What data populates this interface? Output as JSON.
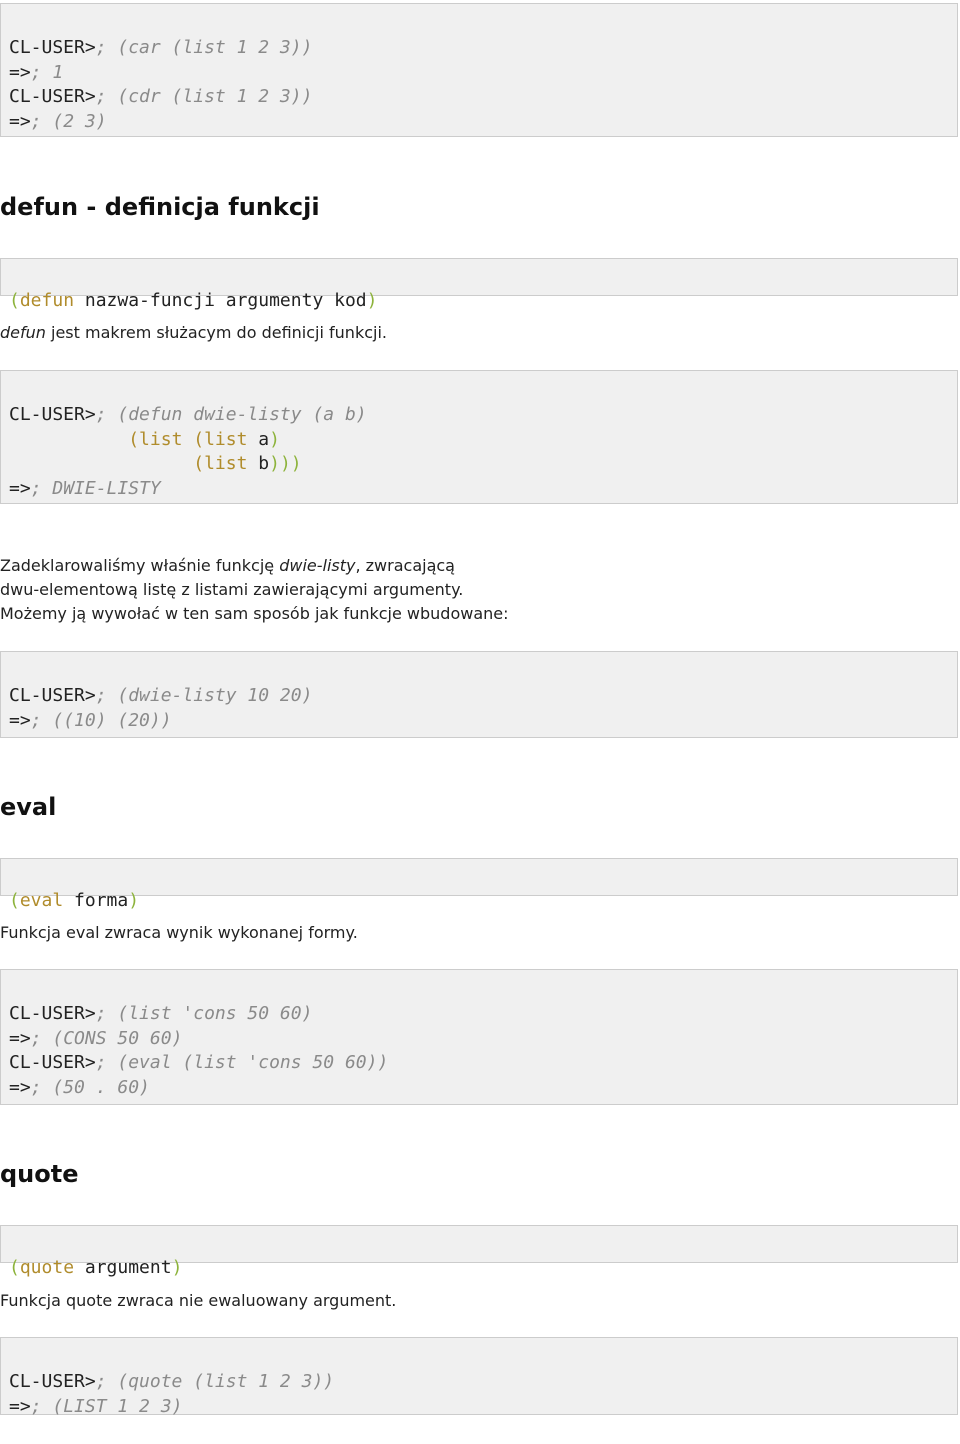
{
  "block1": {
    "l1_prompt": "CL-USER>",
    "l1_code": "; (car (list 1 2 3))",
    "l2_arrow": "=>",
    "l2_code": "; 1",
    "l3_prompt": "CL-USER>",
    "l3_code": "; (cdr (list 1 2 3))",
    "l4_arrow": "=>",
    "l4_code": "; (2 3)"
  },
  "defun_section": {
    "heading": "defun - definicja funkcji",
    "syntax_open": "(",
    "syntax_kw": "defun",
    "syntax_rest": " nazwa-funcji argumenty kod",
    "syntax_close": ")",
    "desc_em": "defun",
    "desc_rest": " jest makrem służacym do definicji funkcji."
  },
  "block2": {
    "l1_prompt": "CL-USER>",
    "l1_code": "; (defun dwie-listy (a b)",
    "l2_indent": "           ",
    "l2_a": "(list (list",
    "l2_b": " a",
    "l2_c": ")",
    "l3_indent": "                 ",
    "l3_a": "(list",
    "l3_b": " b",
    "l3_c": ")))",
    "l4_arrow": "=>",
    "l4_code": "; DWIE-LISTY"
  },
  "para1": {
    "t1": "Zadeklarowaliśmy właśnie funkcję ",
    "em": "dwie-listy",
    "t2": ", zwracającą",
    "line2": "dwu-elementową listę z listami zawierającymi argumenty.",
    "line3": "Możemy ją wywołać w ten sam sposób jak funkcje wbudowane:"
  },
  "block3": {
    "l1_prompt": "CL-USER>",
    "l1_code": "; (dwie-listy 10 20)",
    "l2_arrow": "=>",
    "l2_code": "; ((10) (20))"
  },
  "eval_section": {
    "heading": "eval",
    "syntax_open": "(",
    "syntax_kw": "eval",
    "syntax_rest": " forma",
    "syntax_close": ")",
    "desc": "Funkcja eval zwraca wynik wykonanej formy."
  },
  "block4": {
    "l1_prompt": "CL-USER>",
    "l1_code": "; (list 'cons 50 60)",
    "l2_arrow": "=>",
    "l2_code": "; (CONS 50 60)",
    "l3_prompt": "CL-USER>",
    "l3_code": "; (eval (list 'cons 50 60))",
    "l4_arrow": "=>",
    "l4_code": "; (50 . 60)"
  },
  "quote_section": {
    "heading": "quote",
    "syntax_open": "(",
    "syntax_kw": "quote",
    "syntax_rest": " argument",
    "syntax_close": ")",
    "desc": "Funkcja quote zwraca nie ewaluowany argument."
  },
  "block5": {
    "l1_prompt": "CL-USER>",
    "l1_code": "; (quote (list 1 2 3))",
    "l2_arrow": "=>",
    "l2_code": "; (LIST 1 2 3)"
  },
  "colors": {
    "code_bg": "#f0f0f0",
    "comment": "#8a8a8a",
    "keyword_green": "#8db33b"
  }
}
